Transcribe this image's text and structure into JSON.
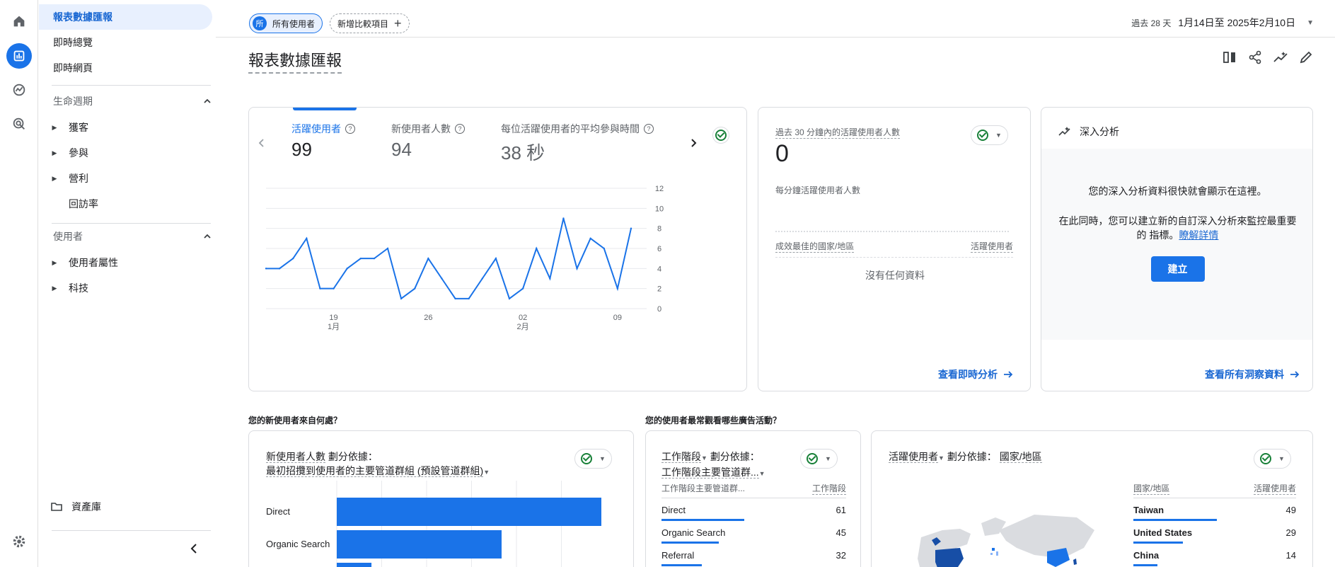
{
  "nav": {
    "report_home": "報表數據匯報",
    "realtime_overview": "即時總覽",
    "realtime_pages": "即時網頁",
    "lifecycle": "生命週期",
    "lifecycle_items": [
      "獲客",
      "參與",
      "營利"
    ],
    "retention": "回訪率",
    "user_section": "使用者",
    "user_items": [
      "使用者屬性",
      "科技"
    ],
    "library": "資產庫"
  },
  "header": {
    "chip_all_avatar": "所",
    "chip_all_label": "所有使用者",
    "chip_add_label": "新增比較項目",
    "date_prefix": "過去 28 天",
    "date_range": "1月14日至 2025年2月10日",
    "page_title": "報表數據匯報"
  },
  "metrics": [
    {
      "label": "活躍使用者",
      "value": "99"
    },
    {
      "label": "新使用者人數",
      "value": "94"
    },
    {
      "label": "每位活躍使用者的平均參與時間",
      "value": "38 秒"
    }
  ],
  "chart_data": {
    "type": "line",
    "x_tick_labels": [
      {
        "day": "19",
        "month": "1月"
      },
      {
        "day": "26",
        "month": ""
      },
      {
        "day": "02",
        "month": "2月"
      },
      {
        "day": "09",
        "month": ""
      }
    ],
    "y_ticks": [
      0,
      2,
      4,
      6,
      8,
      10,
      12
    ],
    "ylim": [
      0,
      12
    ],
    "series": [
      {
        "values": [
          4,
          4,
          5,
          7,
          2,
          2,
          4,
          5,
          5,
          6,
          1,
          2,
          5,
          3,
          1,
          1,
          3,
          5,
          1,
          2,
          6,
          3,
          9,
          4,
          7,
          6,
          2,
          8
        ]
      }
    ],
    "color": "#1a73e8"
  },
  "realtime": {
    "title": "過去 30 分鐘內的活躍使用者人數",
    "value": "0",
    "subtitle": "每分鐘活躍使用者人數",
    "col_country": "成效最佳的國家/地區",
    "col_users": "活躍使用者",
    "empty": "沒有任何資料",
    "link": "查看即時分析"
  },
  "insights": {
    "title": "深入分析",
    "line1": "您的深入分析資料很快就會顯示在這裡。",
    "line2": "在此同時，您可以建立新的自訂深入分析來監控最重要的 指標。",
    "learn_more": "瞭解詳情",
    "create": "建立",
    "link": "查看所有洞察資料"
  },
  "sections": {
    "new_users_q": "您的新使用者來自何處？",
    "campaigns_q": "您的使用者最常觀看哪些廣告活動？"
  },
  "new_users_card": {
    "metric": "新使用者人數",
    "split": "劃分依據：",
    "dimension": "最初招攬到使用者的主要管道群組 (預設管道群組)",
    "bars": [
      {
        "label": "Direct",
        "value": 61
      },
      {
        "label": "Organic Search",
        "value": 38
      },
      {
        "label": "",
        "value": 8
      }
    ]
  },
  "sessions_card": {
    "metric": "工作階段",
    "split": "劃分依據：",
    "dimension": "工作階段主要管道群...",
    "col1": "工作階段主要管道群...",
    "col2": "工作階段",
    "rows": [
      {
        "name": "Direct",
        "value": "61",
        "pct": 0.9
      },
      {
        "name": "Organic Search",
        "value": "45",
        "pct": 0.62
      },
      {
        "name": "Referral",
        "value": "32",
        "pct": 0.44
      }
    ]
  },
  "country_card": {
    "metric": "活躍使用者",
    "split": "劃分依據：",
    "dimension": "國家/地區",
    "col1": "國家/地區",
    "col2": "活躍使用者",
    "rows": [
      {
        "name": "Taiwan",
        "value": "49",
        "pct": 0.62
      },
      {
        "name": "United States",
        "value": "29",
        "pct": 0.37
      },
      {
        "name": "China",
        "value": "14",
        "pct": 0.18
      }
    ]
  }
}
